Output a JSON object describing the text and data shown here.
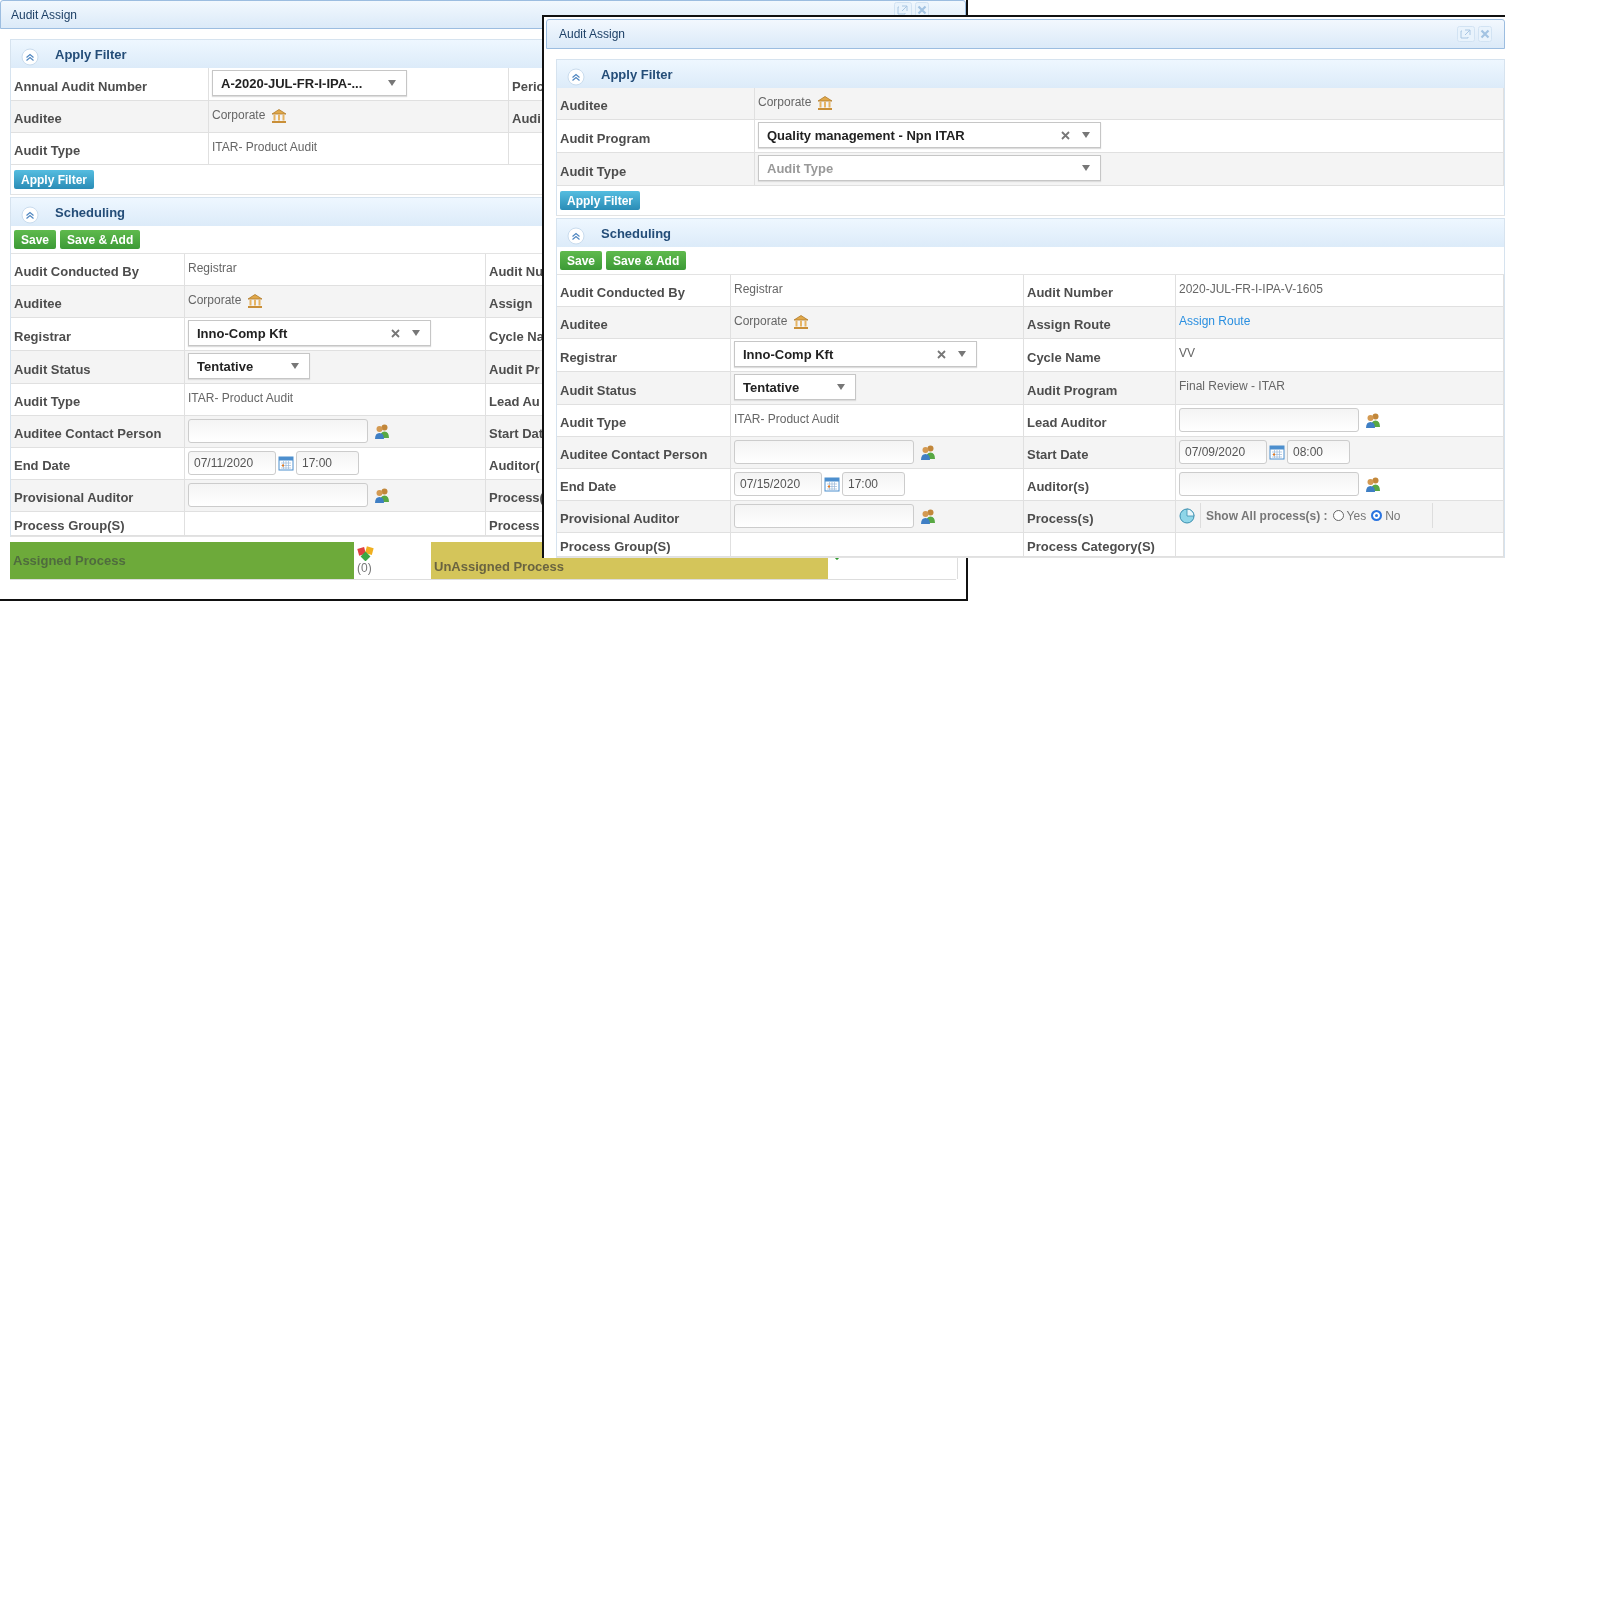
{
  "back_window": {
    "title": "Audit Assign",
    "filter": {
      "title": "Apply Filter",
      "rows": [
        {
          "label": "Annual Audit Number",
          "field": {
            "kind": "select",
            "value": "A-2020-JUL-FR-I-IPA-..."
          },
          "right_label": "Perio"
        },
        {
          "label": "Auditee",
          "field": {
            "kind": "org",
            "value": "Corporate"
          },
          "right_label": "Audi"
        },
        {
          "label": "Audit Type",
          "field": {
            "kind": "text",
            "value": "ITAR- Product Audit"
          }
        }
      ],
      "button": "Apply Filter"
    },
    "scheduling": {
      "title": "Scheduling",
      "buttons": [
        "Save",
        "Save & Add"
      ],
      "rows": [
        {
          "label": "Audit Conducted By",
          "field": {
            "kind": "text",
            "value": "Registrar"
          },
          "right_label": "Audit Nu"
        },
        {
          "label": "Auditee",
          "field": {
            "kind": "org",
            "value": "Corporate"
          },
          "right_label": "Assign"
        },
        {
          "label": "Registrar",
          "field": {
            "kind": "select_clear",
            "value": "Inno-Comp Kft"
          },
          "right_label": "Cycle Na"
        },
        {
          "label": "Audit Status",
          "field": {
            "kind": "select",
            "value": "Tentative"
          },
          "right_label": "Audit Pr"
        },
        {
          "label": "Audit Type",
          "field": {
            "kind": "text",
            "value": "ITAR- Product Audit"
          },
          "right_label": "Lead Au"
        },
        {
          "label": "Auditee Contact Person",
          "field": {
            "kind": "lookup"
          },
          "right_label": "Start Dat"
        },
        {
          "label": "End Date",
          "field": {
            "kind": "datetime",
            "date": "07/11/2020",
            "time": "17:00"
          },
          "right_label": "Auditor("
        },
        {
          "label": "Provisional Auditor",
          "field": {
            "kind": "lookup"
          },
          "right_label": "Process("
        },
        {
          "label": "Process Group(S)",
          "right_label": "Process"
        }
      ]
    },
    "process_bar": {
      "assigned_label": "Assigned Process",
      "assigned_count": "(0)",
      "unassigned_label": "UnAssigned Process"
    }
  },
  "front_window": {
    "title": "Audit Assign",
    "filter": {
      "title": "Apply Filter",
      "rows": [
        {
          "label": "Auditee",
          "field": {
            "kind": "org",
            "value": "Corporate"
          }
        },
        {
          "label": "Audit Program",
          "field": {
            "kind": "select_clear",
            "value": "Quality management - Npn ITAR"
          }
        },
        {
          "label": "Audit Type",
          "field": {
            "kind": "select",
            "placeholder": "Audit Type"
          }
        }
      ],
      "button": "Apply Filter"
    },
    "scheduling": {
      "title": "Scheduling",
      "buttons": [
        "Save",
        "Save & Add"
      ],
      "rows": [
        {
          "label": "Audit Conducted By",
          "field": {
            "kind": "text",
            "value": "Registrar"
          },
          "right_label": "Audit Number",
          "right_field": {
            "kind": "text",
            "value": "2020-JUL-FR-I-IPA-V-1605"
          }
        },
        {
          "label": "Auditee",
          "field": {
            "kind": "org",
            "value": "Corporate"
          },
          "right_label": "Assign Route",
          "right_field": {
            "kind": "link",
            "value": "Assign Route"
          }
        },
        {
          "label": "Registrar",
          "field": {
            "kind": "select_clear",
            "value": "Inno-Comp Kft"
          },
          "right_label": "Cycle Name",
          "right_field": {
            "kind": "text",
            "value": "VV"
          }
        },
        {
          "label": "Audit Status",
          "field": {
            "kind": "select",
            "value": "Tentative"
          },
          "right_label": "Audit Program",
          "right_field": {
            "kind": "text",
            "value": "Final Review - ITAR"
          }
        },
        {
          "label": "Audit Type",
          "field": {
            "kind": "text",
            "value": "ITAR- Product Audit"
          },
          "right_label": "Lead Auditor",
          "right_field": {
            "kind": "lookup"
          }
        },
        {
          "label": "Auditee Contact Person",
          "field": {
            "kind": "lookup"
          },
          "right_label": "Start Date",
          "right_field": {
            "kind": "datetime",
            "date": "07/09/2020",
            "time": "08:00"
          }
        },
        {
          "label": "End Date",
          "field": {
            "kind": "datetime",
            "date": "07/15/2020",
            "time": "17:00"
          },
          "right_label": "Auditor(s)",
          "right_field": {
            "kind": "lookup"
          }
        },
        {
          "label": "Provisional Auditor",
          "field": {
            "kind": "lookup"
          },
          "right_label": "Process(s)",
          "right_field": {
            "kind": "process_toggle",
            "label": "Show All process(s) :",
            "options": [
              {
                "label": "Yes",
                "selected": false
              },
              {
                "label": "No",
                "selected": true
              }
            ]
          }
        },
        {
          "label": "Process Group(S)",
          "right_label": "Process Category(S)"
        }
      ]
    }
  }
}
